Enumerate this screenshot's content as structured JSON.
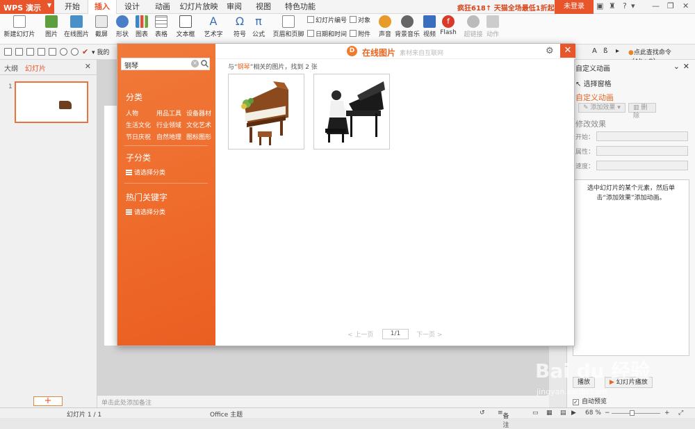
{
  "titlebar": {
    "app_name": "WPS 演示",
    "tabs": [
      "开始",
      "插入",
      "设计",
      "动画",
      "幻灯片放映",
      "审阅",
      "视图",
      "特色功能"
    ],
    "active_tab": "插入",
    "promo": "疯狂618↑ 天猫全场最低1折起",
    "login": "未登录",
    "help": "?"
  },
  "ribbon": {
    "new_slide": "新建幻灯片",
    "picture": "图片",
    "online_picture": "在线图片",
    "screenshot": "截屏",
    "shape": "形状",
    "chart": "图表",
    "table": "表格",
    "textbox": "文本框",
    "wordart": "艺术字",
    "symbol": "符号",
    "formula": "公式",
    "header_footer": "页眉和页脚",
    "slide_number": "幻灯片编号",
    "object": "对象",
    "date_time": "日期和时间",
    "attachment": "附件",
    "sound": "声音",
    "bg_music": "背景音乐",
    "video": "视频",
    "flash": "Flash",
    "hyperlink": "超链接",
    "action": "动作"
  },
  "qab": {
    "my_item": "我的",
    "search_command": "点此查找命令（Alt+Q）"
  },
  "left_panel": {
    "tab_outline": "大纲",
    "tab_slides": "幻灯片",
    "slide_number": "1",
    "add_button": "+"
  },
  "notes_placeholder": "单击此处添加备注",
  "task_pane": {
    "title": "自定义动画",
    "select_pane": "选择窗格",
    "custom_animation": "自定义动画",
    "add_effect": "添加效果",
    "delete": "删除",
    "modify_effect": "修改效果",
    "start_label": "开始：",
    "property_label": "属性：",
    "speed_label": "速度：",
    "hint": "选中幻灯片的某个元素，然后单击“添加效果”添加动画。",
    "play": "播放",
    "slideshow": "幻灯片播放",
    "auto_preview": "自动预览"
  },
  "status": {
    "slide_info": "幻灯片 1 / 1",
    "theme": "Office 主题",
    "notes": "备注",
    "zoom": "68 %"
  },
  "dialog": {
    "search_value": "钢琴",
    "title": "在线图片",
    "subtitle": "素材来自互联网",
    "category_heading": "分类",
    "categories": [
      "人物",
      "用品工具",
      "设备器材",
      "生活文化",
      "行业领域",
      "文化艺术",
      "节日庆祝",
      "自然地理",
      "图标图形"
    ],
    "subcategory_heading": "子分类",
    "select_category": "请选择分类",
    "hot_keywords_heading": "热门关键字",
    "result_prefix": "与“",
    "result_keyword": "钢琴",
    "result_suffix": "”相关的图片，找到 2 张",
    "prev_page": "< 上一页",
    "page": "1/1",
    "next_page": "下一页 >"
  },
  "watermark": {
    "text": "Bai du 经验",
    "url": "jingyan.baidu.com"
  }
}
